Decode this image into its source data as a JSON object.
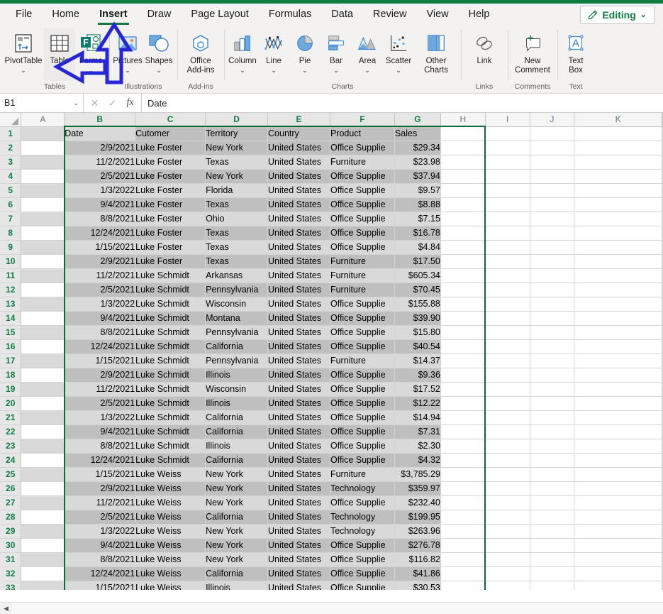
{
  "window": {
    "accent_color": "#107C41",
    "annotation_color": "#2727D8"
  },
  "ribbon": {
    "tabs": [
      {
        "label": "File",
        "active": false
      },
      {
        "label": "Home",
        "active": false
      },
      {
        "label": "Insert",
        "active": true
      },
      {
        "label": "Draw",
        "active": false
      },
      {
        "label": "Page Layout",
        "active": false
      },
      {
        "label": "Formulas",
        "active": false
      },
      {
        "label": "Data",
        "active": false
      },
      {
        "label": "Review",
        "active": false
      },
      {
        "label": "View",
        "active": false
      },
      {
        "label": "Help",
        "active": false
      }
    ],
    "editing_button": {
      "label": "Editing",
      "icon": "pencil-icon",
      "chevron": "⌄"
    },
    "groups": [
      {
        "name": "Tables",
        "label": "Tables",
        "buttons": [
          {
            "label": "PivotTable",
            "icon": "pivottable-icon",
            "dropdown": "⌄",
            "hover": false
          },
          {
            "label": "Table",
            "icon": "table-icon",
            "dropdown": "",
            "hover": true
          },
          {
            "label": "Forms",
            "icon": "forms-icon",
            "dropdown": "⌄",
            "hover": false
          }
        ]
      },
      {
        "name": "Illustrations",
        "label": "Illustrations",
        "buttons": [
          {
            "label": "Pictures",
            "icon": "pictures-icon",
            "dropdown": "⌄",
            "hover": false
          },
          {
            "label": "Shapes",
            "icon": "shapes-icon",
            "dropdown": "⌄",
            "hover": false
          }
        ]
      },
      {
        "name": "Add-ins",
        "label": "Add-ins",
        "buttons": [
          {
            "label": "Office Add-ins",
            "icon": "office-addins-icon",
            "dropdown": "",
            "hover": false
          }
        ]
      },
      {
        "name": "Charts",
        "label": "Charts",
        "buttons": [
          {
            "label": "Column",
            "icon": "column-chart-icon",
            "dropdown": "⌄",
            "hover": false
          },
          {
            "label": "Line",
            "icon": "line-chart-icon",
            "dropdown": "⌄",
            "hover": false
          },
          {
            "label": "Pie",
            "icon": "pie-chart-icon",
            "dropdown": "⌄",
            "hover": false
          },
          {
            "label": "Bar",
            "icon": "bar-chart-icon",
            "dropdown": "⌄",
            "hover": false
          },
          {
            "label": "Area",
            "icon": "area-chart-icon",
            "dropdown": "⌄",
            "hover": false
          },
          {
            "label": "Scatter",
            "icon": "scatter-chart-icon",
            "dropdown": "⌄",
            "hover": false
          },
          {
            "label": "Other Charts",
            "icon": "other-charts-icon",
            "dropdown": "⌄",
            "hover": false
          }
        ]
      },
      {
        "name": "Links",
        "label": "Links",
        "buttons": [
          {
            "label": "Link",
            "icon": "link-icon",
            "dropdown": "",
            "hover": false
          }
        ]
      },
      {
        "name": "Comments",
        "label": "Comments",
        "buttons": [
          {
            "label": "New Comment",
            "icon": "new-comment-icon",
            "dropdown": "",
            "hover": false
          }
        ]
      },
      {
        "name": "Text",
        "label": "Text",
        "buttons": [
          {
            "label": "Text Box",
            "icon": "text-box-icon",
            "dropdown": "",
            "hover": false
          }
        ]
      }
    ]
  },
  "formula_bar": {
    "name_box": "B1",
    "name_box_chevron": "⌄",
    "cancel_icon": "✕",
    "enter_icon": "✓",
    "function_icon": "fx",
    "value": "Date"
  },
  "grid": {
    "column_headers": [
      "A",
      "B",
      "C",
      "D",
      "E",
      "F",
      "G",
      "H",
      "I",
      "J",
      "K"
    ],
    "row_numbers": [
      1,
      2,
      3,
      4,
      5,
      6,
      7,
      8,
      9,
      10,
      11,
      12,
      13,
      14,
      15,
      16,
      17,
      18,
      19,
      20,
      21,
      22,
      23,
      24,
      25,
      26,
      27,
      28,
      29,
      30,
      31,
      32,
      33
    ],
    "selection_range": "B1:G33",
    "table_headers": [
      "Date",
      "Cutomer",
      "Territory",
      "Country",
      "Product",
      "Sales"
    ],
    "rows": [
      [
        "2/9/2021",
        "Luke Foster",
        "New York",
        "United States",
        "Office Supplie",
        "$29.34"
      ],
      [
        "11/2/2021",
        "Luke Foster",
        "Texas",
        "United States",
        "Furniture",
        "$23.98"
      ],
      [
        "2/5/2021",
        "Luke Foster",
        "New York",
        "United States",
        "Office Supplie",
        "$37.94"
      ],
      [
        "1/3/2022",
        "Luke Foster",
        "Florida",
        "United States",
        "Office Supplie",
        "$9.57"
      ],
      [
        "9/4/2021",
        "Luke Foster",
        "Texas",
        "United States",
        "Office Supplie",
        "$8.88"
      ],
      [
        "8/8/2021",
        "Luke Foster",
        "Ohio",
        "United States",
        "Office Supplie",
        "$7.15"
      ],
      [
        "12/24/2021",
        "Luke Foster",
        "Texas",
        "United States",
        "Office Supplie",
        "$16.78"
      ],
      [
        "1/15/2021",
        "Luke Foster",
        "Texas",
        "United States",
        "Office Supplie",
        "$4.84"
      ],
      [
        "2/9/2021",
        "Luke Foster",
        "Texas",
        "United States",
        "Furniture",
        "$17.50"
      ],
      [
        "11/2/2021",
        "Luke Schmidt",
        "Arkansas",
        "United States",
        "Furniture",
        "$605.34"
      ],
      [
        "2/5/2021",
        "Luke Schmidt",
        "Pennsylvania",
        "United States",
        "Furniture",
        "$70.45"
      ],
      [
        "1/3/2022",
        "Luke Schmidt",
        "Wisconsin",
        "United States",
        "Office Supplie",
        "$155.88"
      ],
      [
        "9/4/2021",
        "Luke Schmidt",
        "Montana",
        "United States",
        "Office Supplie",
        "$39.90"
      ],
      [
        "8/8/2021",
        "Luke Schmidt",
        "Pennsylvania",
        "United States",
        "Office Supplie",
        "$15.80"
      ],
      [
        "12/24/2021",
        "Luke Schmidt",
        "California",
        "United States",
        "Office Supplie",
        "$40.54"
      ],
      [
        "1/15/2021",
        "Luke Schmidt",
        "Pennsylvania",
        "United States",
        "Furniture",
        "$14.37"
      ],
      [
        "2/9/2021",
        "Luke Schmidt",
        "Illinois",
        "United States",
        "Office Supplie",
        "$9.36"
      ],
      [
        "11/2/2021",
        "Luke Schmidt",
        "Wisconsin",
        "United States",
        "Office Supplie",
        "$17.52"
      ],
      [
        "2/5/2021",
        "Luke Schmidt",
        "Illinois",
        "United States",
        "Office Supplie",
        "$12.22"
      ],
      [
        "1/3/2022",
        "Luke Schmidt",
        "California",
        "United States",
        "Office Supplie",
        "$14.94"
      ],
      [
        "9/4/2021",
        "Luke Schmidt",
        "California",
        "United States",
        "Office Supplie",
        "$7.31"
      ],
      [
        "8/8/2021",
        "Luke Schmidt",
        "Illinois",
        "United States",
        "Office Supplie",
        "$2.30"
      ],
      [
        "12/24/2021",
        "Luke Schmidt",
        "California",
        "United States",
        "Office Supplie",
        "$4.32"
      ],
      [
        "1/15/2021",
        "Luke Weiss",
        "New York",
        "United States",
        "Furniture",
        "$3,785.29"
      ],
      [
        "2/9/2021",
        "Luke Weiss",
        "New York",
        "United States",
        "Technology",
        "$359.97"
      ],
      [
        "11/2/2021",
        "Luke Weiss",
        "New York",
        "United States",
        "Office Supplie",
        "$232.40"
      ],
      [
        "2/5/2021",
        "Luke Weiss",
        "California",
        "United States",
        "Technology",
        "$199.95"
      ],
      [
        "1/3/2022",
        "Luke Weiss",
        "New York",
        "United States",
        "Technology",
        "$263.96"
      ],
      [
        "9/4/2021",
        "Luke Weiss",
        "New York",
        "United States",
        "Office Supplie",
        "$276.78"
      ],
      [
        "8/8/2021",
        "Luke Weiss",
        "New York",
        "United States",
        "Office Supplie",
        "$116.82"
      ],
      [
        "12/24/2021",
        "Luke Weiss",
        "California",
        "United States",
        "Office Supplie",
        "$41.86"
      ],
      [
        "1/15/2021",
        "Luke Weiss",
        "Illinois",
        "United States",
        "Office Supplie",
        "$30.53"
      ]
    ]
  },
  "scrollbar": {
    "left_arrow": "◀",
    "right_arrow": "▶"
  },
  "annotations": [
    {
      "name": "arrow-up-to-insert-tab",
      "direction": "up",
      "target": "Insert"
    },
    {
      "name": "arrow-left-to-table-button",
      "direction": "left",
      "target": "Table"
    }
  ]
}
